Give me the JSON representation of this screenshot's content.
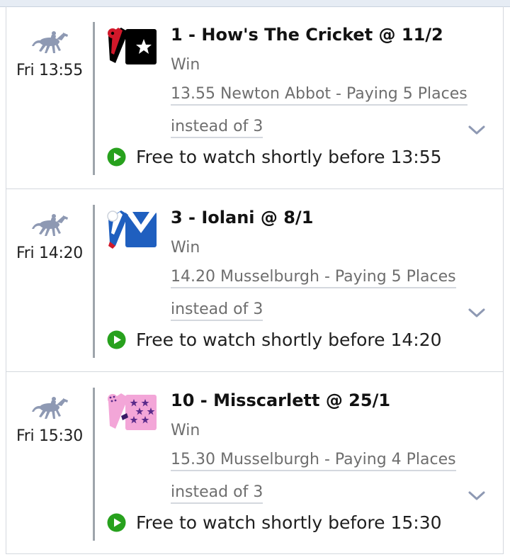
{
  "colors": {
    "horse_icon": "#8e99b3",
    "divider": "#9ea4ab",
    "play_green": "#27a11d",
    "promo_text": "#6e6e6e"
  },
  "races": [
    {
      "time_label": "Fri 13:55",
      "selection": "1 - How's The Cricket @ 11/2",
      "bet_type": "Win",
      "promo_line1": "13.55 Newton Abbot - Paying 5 Places",
      "promo_line2": "instead of 3",
      "watch_text": "Free to watch shortly before 13:55",
      "silk": "black-red-silk-icon"
    },
    {
      "time_label": "Fri 14:20",
      "selection": "3 - Iolani @ 8/1",
      "bet_type": "Win",
      "promo_line1": "14.20 Musselburgh - Paying 5 Places",
      "promo_line2": "instead of 3",
      "watch_text": "Free to watch shortly before 14:20",
      "silk": "blue-white-silk-icon"
    },
    {
      "time_label": "Fri 15:30",
      "selection": "10 - Misscarlett @ 25/1",
      "bet_type": "Win",
      "promo_line1": "15.30 Musselburgh - Paying 4 Places",
      "promo_line2": "instead of 3",
      "watch_text": "Free to watch shortly before 15:30",
      "silk": "pink-purple-stars-silk-icon"
    }
  ]
}
